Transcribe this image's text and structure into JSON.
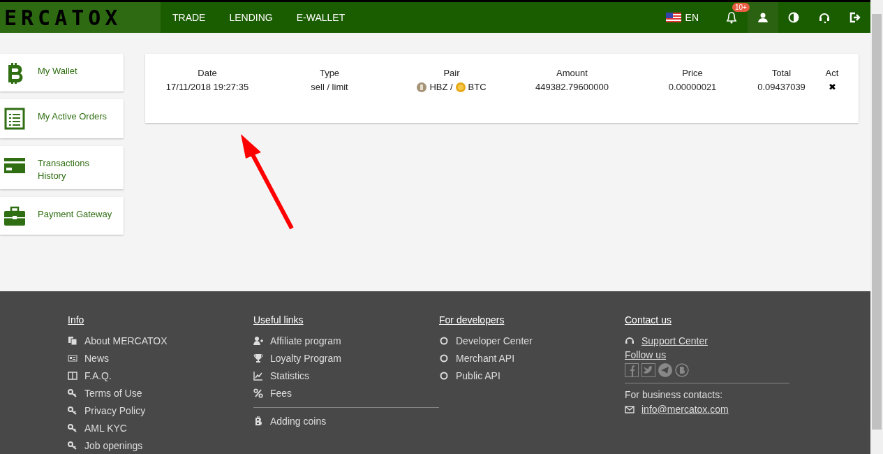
{
  "topbar": {
    "logo": "ERCATOX",
    "nav": [
      {
        "label": "TRADE"
      },
      {
        "label": "LENDING"
      },
      {
        "label": "E-WALLET"
      }
    ],
    "language": "EN",
    "notification_badge": "10+",
    "actions": [
      {
        "kind": "user",
        "selected": true
      },
      {
        "kind": "contrast",
        "selected": false
      },
      {
        "kind": "support",
        "selected": false
      },
      {
        "kind": "logout",
        "selected": false
      }
    ]
  },
  "sidebar": {
    "items": [
      {
        "kind": "wallet",
        "label": "My Wallet"
      },
      {
        "kind": "orders",
        "label": "My Active Orders"
      },
      {
        "kind": "history",
        "label": "Transactions History"
      },
      {
        "kind": "gateway",
        "label": "Payment Gateway"
      }
    ]
  },
  "orders_table": {
    "columns": [
      "Date",
      "Type",
      "Pair",
      "Amount",
      "Price",
      "Total",
      "Act"
    ],
    "rows": [
      {
        "date": "17/11/2018 19:27:35",
        "type": "sell / limit",
        "base": "HBZ /",
        "quote": "BTC",
        "amount": "449382.79600000",
        "price": "0.00000021",
        "total": "0.09437039",
        "action": "✖"
      }
    ]
  },
  "footer": {
    "columns": [
      {
        "title": "Info",
        "links": [
          {
            "kind": "copy",
            "label": "About MERCATOX"
          },
          {
            "kind": "news",
            "label": "News"
          },
          {
            "kind": "columns",
            "label": "F.A.Q."
          },
          {
            "kind": "key",
            "label": "Terms of Use"
          },
          {
            "kind": "key",
            "label": "Privacy Policy"
          },
          {
            "kind": "key",
            "label": "AML KYC"
          },
          {
            "kind": "key",
            "label": "Job openings"
          }
        ]
      },
      {
        "title": "Useful links",
        "links": [
          {
            "kind": "user-plus",
            "label": "Affiliate program"
          },
          {
            "kind": "trophy",
            "label": "Loyalty Program"
          },
          {
            "kind": "chart",
            "label": "Statistics"
          },
          {
            "kind": "percent",
            "label": "Fees"
          },
          {
            "kind": "bitcoin",
            "label": "Adding coins",
            "separated": true
          }
        ]
      },
      {
        "title": "For developers",
        "links": [
          {
            "kind": "circle",
            "label": "Developer Center"
          },
          {
            "kind": "circle",
            "label": "Merchant API"
          },
          {
            "kind": "circle",
            "label": "Public API"
          }
        ]
      }
    ],
    "contact": {
      "title": "Contact us",
      "support": "Support Center",
      "follow": "Follow us",
      "business": "For business contacts:",
      "email": "info@mercatox.com"
    }
  }
}
